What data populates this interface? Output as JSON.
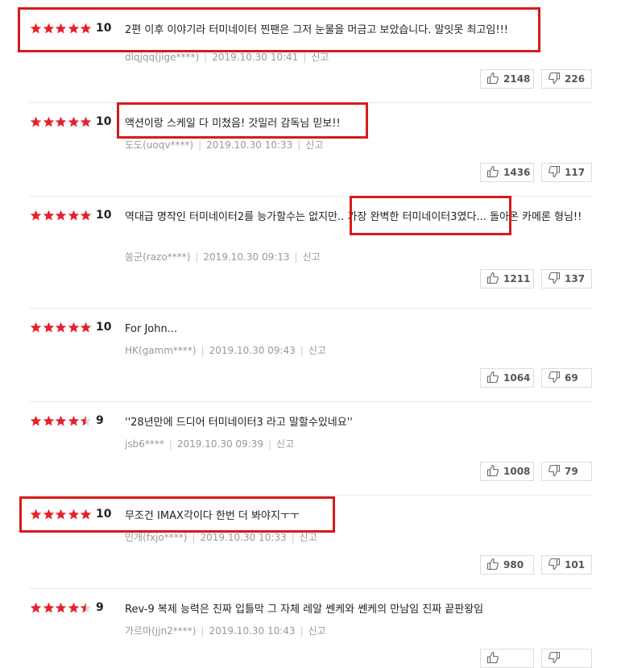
{
  "colors": {
    "star_filled": "#e8202a",
    "star_empty": "#d8d8d8",
    "highlight": "#d61a1a"
  },
  "reviews": [
    {
      "score": "10",
      "rating": 5,
      "text": "2편 이후 이야기라 터미네이터 찐팬은 그저 눈물을 머금고 보았습니다. 말잇못 최고임!!!",
      "author": "dlqjqq(jige****)",
      "date": "2019.10.30 10:41",
      "report": "신고",
      "likes": "2148",
      "dislikes": "226"
    },
    {
      "score": "10",
      "rating": 5,
      "text": "액션이랑 스케일 다 미쳤음! 갓밀러 감독님 믿보!!",
      "author": "도도(uoqv****)",
      "date": "2019.10.30 10:33",
      "report": "신고",
      "likes": "1436",
      "dislikes": "117"
    },
    {
      "score": "10",
      "rating": 5,
      "text": "역대급 명작인 터미네이터2를 능가할수는 없지만.. 가장 완벽한 터미네이터3였다... 돌아온 카메론 형님!!",
      "author": "쏭군(razo****)",
      "date": "2019.10.30 09:13",
      "report": "신고",
      "likes": "1211",
      "dislikes": "137"
    },
    {
      "score": "10",
      "rating": 5,
      "text": "For John...",
      "author": "HK(gamm****)",
      "date": "2019.10.30 09:43",
      "report": "신고",
      "likes": "1064",
      "dislikes": "69"
    },
    {
      "score": "9",
      "rating": 4.5,
      "text": "''28년만에 드디어 터미네이터3 라고 말할수있네요''",
      "author": "jsb6****",
      "date": "2019.10.30 09:39",
      "report": "신고",
      "likes": "1008",
      "dislikes": "79"
    },
    {
      "score": "10",
      "rating": 5,
      "text": "무조건 IMAX각이다 한번 더 봐야지ㅜㅜ",
      "author": "민개(fxjo****)",
      "date": "2019.10.30 10:33",
      "report": "신고",
      "likes": "980",
      "dislikes": "101"
    },
    {
      "score": "9",
      "rating": 4.5,
      "text": "Rev-9 복제 능력은 진짜 입틀막 그 자체 레알 쎈케와 쎈케의 만남임 진짜 끝판왕임",
      "author": "가르마(jjn2****)",
      "date": "2019.10.30 10:43",
      "report": "신고",
      "likes": "",
      "dislikes": ""
    }
  ]
}
